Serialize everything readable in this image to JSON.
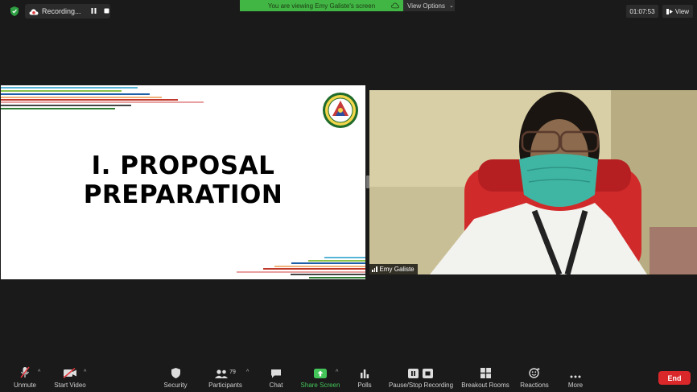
{
  "topbar": {
    "security_icon": "shield-check-icon",
    "recording_label": "Recording...",
    "banner_text": "You are viewing Emy Galiste's screen",
    "view_options_label": "View Options",
    "timer": "01:07:53",
    "view_label": "View"
  },
  "slide": {
    "title_line1": "I. PROPOSAL",
    "title_line2": "PREPARATION",
    "seal_icon": "university-seal-icon"
  },
  "video": {
    "participant_name": "Emy Galiste"
  },
  "toolbar": {
    "unmute": "Unmute",
    "start_video": "Start Video",
    "security": "Security",
    "participants": "Participants",
    "participants_count": "79",
    "chat": "Chat",
    "share_screen": "Share Screen",
    "polls": "Polls",
    "pause_stop_recording": "Pause/Stop Recording",
    "breakout_rooms": "Breakout Rooms",
    "reactions": "Reactions",
    "more": "More",
    "end": "End"
  },
  "colors": {
    "share_green": "#44c55a",
    "banner_green": "#41b645",
    "end_red": "#d9272a"
  }
}
